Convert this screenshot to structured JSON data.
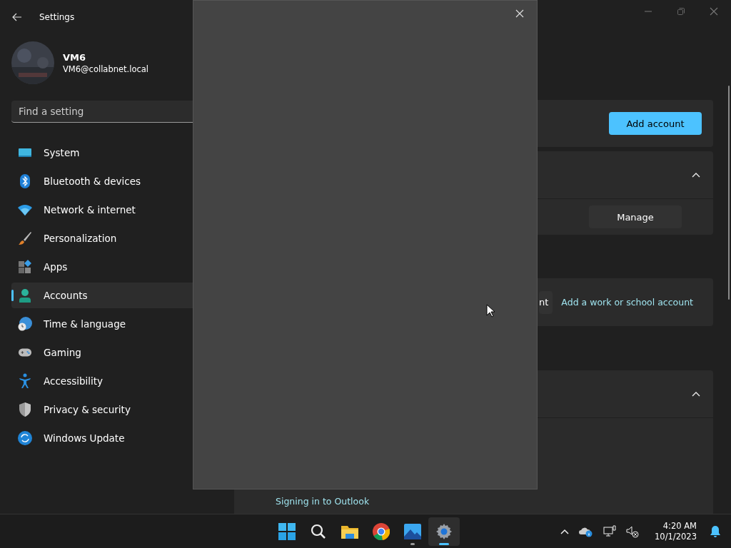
{
  "window": {
    "title": "Settings"
  },
  "user": {
    "name": "VM6",
    "email": "VM6@collabnet.local"
  },
  "search": {
    "placeholder": "Find a setting"
  },
  "nav": [
    {
      "label": "System",
      "kind": "system",
      "selected": false
    },
    {
      "label": "Bluetooth & devices",
      "kind": "bluetooth",
      "selected": false
    },
    {
      "label": "Network & internet",
      "kind": "wifi",
      "selected": false
    },
    {
      "label": "Personalization",
      "kind": "brush",
      "selected": false
    },
    {
      "label": "Apps",
      "kind": "apps",
      "selected": false
    },
    {
      "label": "Accounts",
      "kind": "person",
      "selected": true
    },
    {
      "label": "Time & language",
      "kind": "globe",
      "selected": false
    },
    {
      "label": "Gaming",
      "kind": "gamepad",
      "selected": false
    },
    {
      "label": "Accessibility",
      "kind": "accessibility",
      "selected": false
    },
    {
      "label": "Privacy & security",
      "kind": "shield",
      "selected": false
    },
    {
      "label": "Windows Update",
      "kind": "update",
      "selected": false
    }
  ],
  "content": {
    "add_account_button": "Add account",
    "sections": [
      {
        "expanded": true
      },
      {
        "expanded": true
      }
    ],
    "manage_button": "Manage",
    "partial_button": "nt",
    "work_link": "Add a work or school account",
    "outlook_link": "Signing in to Outlook"
  },
  "taskbar": {
    "apps": [
      {
        "kind": "start",
        "active": false,
        "running": false
      },
      {
        "kind": "search",
        "active": false,
        "running": false
      },
      {
        "kind": "folder",
        "active": false,
        "running": false
      },
      {
        "kind": "browser",
        "active": false,
        "running": false
      },
      {
        "kind": "photos",
        "active": false,
        "running": true
      },
      {
        "kind": "settings",
        "active": true,
        "running": true
      }
    ],
    "time": "4:20 AM",
    "date": "10/1/2023"
  }
}
